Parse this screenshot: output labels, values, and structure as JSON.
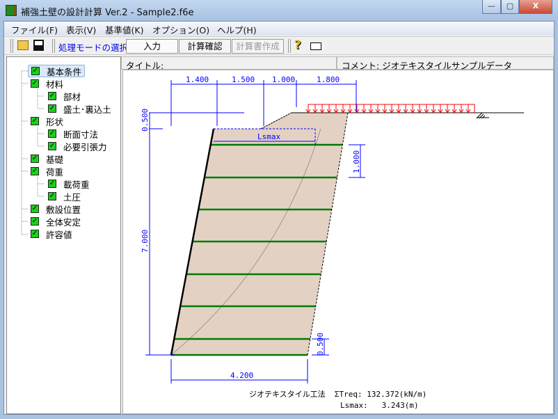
{
  "window": {
    "title": "補強土壁の設計計算 Ver.2 - Sample2.f6e",
    "min": "—",
    "max": "▢",
    "close": "X"
  },
  "menu": [
    "ファイル(F)",
    "表示(V)",
    "基準値(K)",
    "オプション(O)",
    "ヘルプ(H)"
  ],
  "toolbar": {
    "mode_label": "処理モードの選択",
    "input": "入力",
    "calc_check": "計算確認",
    "report": "計算書作成"
  },
  "tree": [
    {
      "label": "基本条件",
      "level": 0,
      "selected": true
    },
    {
      "label": "材料",
      "level": 0
    },
    {
      "label": "部材",
      "level": 1
    },
    {
      "label": "盛土･裏込土",
      "level": 1
    },
    {
      "label": "形状",
      "level": 0
    },
    {
      "label": "断面寸法",
      "level": 1
    },
    {
      "label": "必要引張力",
      "level": 1
    },
    {
      "label": "基礎",
      "level": 0
    },
    {
      "label": "荷重",
      "level": 0
    },
    {
      "label": "載荷重",
      "level": 1
    },
    {
      "label": "土圧",
      "level": 1
    },
    {
      "label": "敷設位置",
      "level": 0
    },
    {
      "label": "全体安定",
      "level": 0
    },
    {
      "label": "許容値",
      "level": 0
    }
  ],
  "header": {
    "title_label": "タイトル:",
    "title_value": "",
    "comment_label": "コメント:",
    "comment_value": "ジオテキスタイルサンプルデータ"
  },
  "drawing": {
    "top_dims": [
      "1.400",
      "1.500",
      "1.000",
      "1.800"
    ],
    "left_dims": [
      "0.500",
      "7.000"
    ],
    "spacing_dim": "1.000",
    "bottom_spacing_dim": "0.500",
    "base_dim": "4.200",
    "lsmax_label": "Lsmax",
    "result_line1": "ジオテキスタイル工法  ΣTreq: 132.372(kN/m)",
    "result_line2": "Lsmax:   3.243(m)",
    "colors": {
      "dim": "#0000ff",
      "load": "#ff0000",
      "reinforcement": "#007a00",
      "fill": "#e3d2c4"
    }
  }
}
